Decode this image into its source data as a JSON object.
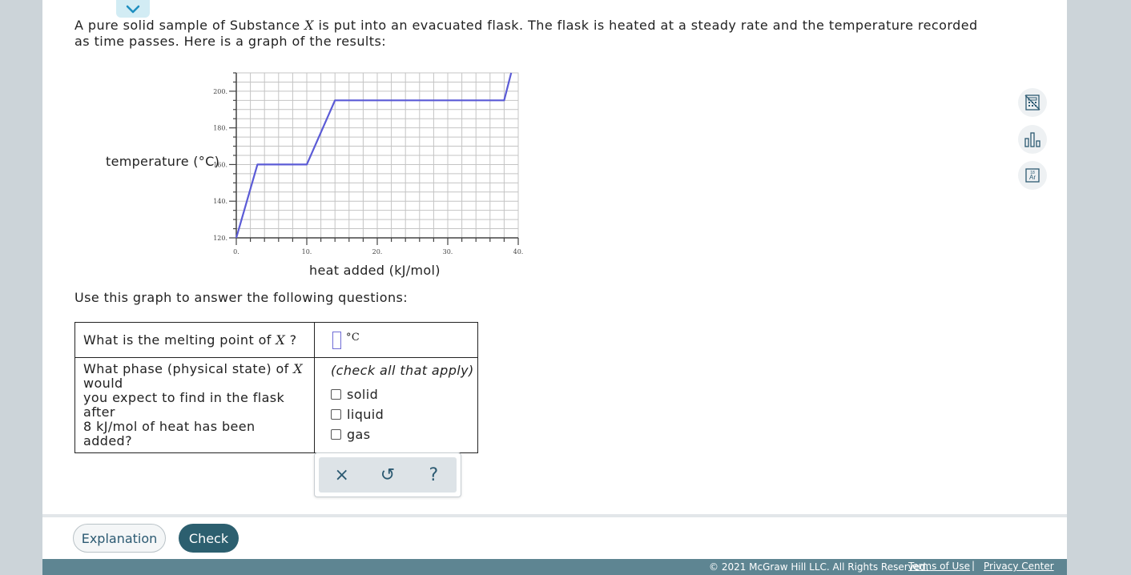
{
  "intro": {
    "part1": "A pure solid sample of Substance ",
    "var": "X",
    "part2": " is put into an evacuated flask. The flask is heated at a steady rate and the temperature recorded as time passes. Here is a graph of the results:"
  },
  "chart_data": {
    "type": "line",
    "xlabel": "heat added (kJ/mol)",
    "ylabel": "temperature (°C)",
    "xlim": [
      0,
      40
    ],
    "ylim": [
      120,
      210
    ],
    "x_ticks": [
      "0.",
      "10.",
      "20.",
      "30.",
      "40."
    ],
    "y_ticks": [
      "120.",
      "140.",
      "160.",
      "180.",
      "200."
    ],
    "grid": true,
    "series": [
      {
        "color": "#5b5bd6",
        "points": [
          [
            0,
            120
          ],
          [
            3,
            160
          ],
          [
            10,
            160
          ],
          [
            14,
            195
          ],
          [
            38,
            195
          ],
          [
            39,
            210
          ]
        ]
      }
    ]
  },
  "prompt": "Use this graph to answer the following questions:",
  "questions": {
    "q1": {
      "pre": "What is the melting point of ",
      "var": "X",
      "post": " ?",
      "unit": "°C"
    },
    "q2": {
      "line1_pre": "What phase (physical state) of ",
      "var": "X",
      "line1_post": " would",
      "line2": "you expect to find in the flask after",
      "line3": "8 kJ/mol of heat has been added?",
      "hint": "(check all that apply)",
      "options": [
        "solid",
        "liquid",
        "gas"
      ]
    }
  },
  "toolbox": {
    "clear": "×",
    "undo": "↺",
    "help": "?"
  },
  "buttons": {
    "explanation": "Explanation",
    "check": "Check"
  },
  "footer": {
    "copyright": "© 2021 McGraw Hill LLC. All Rights Reserved.",
    "terms": "Terms of Use",
    "separator": "|",
    "privacy": "Privacy Center"
  }
}
